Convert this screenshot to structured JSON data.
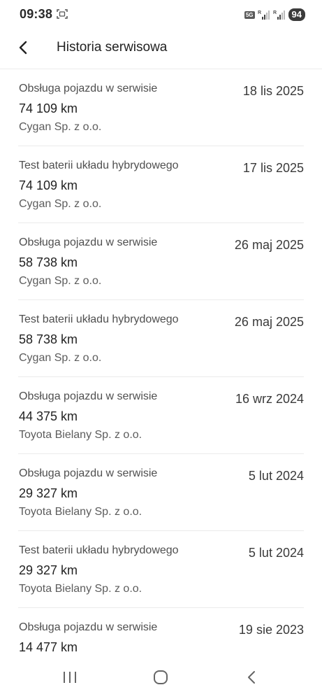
{
  "status_bar": {
    "time": "09:38",
    "network": "5G",
    "battery": "94"
  },
  "header": {
    "title": "Historia serwisowa"
  },
  "entries": [
    {
      "title": "Obsługa pojazdu w serwisie",
      "date": "18 lis 2025",
      "km": "74 109 km",
      "provider": "Cygan Sp. z o.o."
    },
    {
      "title": "Test baterii układu hybrydowego",
      "date": "17 lis 2025",
      "km": "74 109 km",
      "provider": "Cygan Sp. z o.o."
    },
    {
      "title": "Obsługa pojazdu w serwisie",
      "date": "26 maj 2025",
      "km": "58 738 km",
      "provider": "Cygan Sp. z o.o."
    },
    {
      "title": "Test baterii układu hybrydowego",
      "date": "26 maj 2025",
      "km": "58 738 km",
      "provider": "Cygan Sp. z o.o."
    },
    {
      "title": "Obsługa pojazdu w serwisie",
      "date": "16 wrz 2024",
      "km": "44 375 km",
      "provider": "Toyota Bielany Sp. z o.o."
    },
    {
      "title": "Obsługa pojazdu w serwisie",
      "date": "5 lut 2024",
      "km": "29 327 km",
      "provider": "Toyota Bielany Sp. z o.o."
    },
    {
      "title": "Test baterii układu hybrydowego",
      "date": "5 lut 2024",
      "km": "29 327 km",
      "provider": "Toyota Bielany Sp. z o.o."
    },
    {
      "title": "Obsługa pojazdu w serwisie",
      "date": "19 sie 2023",
      "km": "14 477 km",
      "provider": ""
    }
  ],
  "icons": {
    "back": "chevron-left-icon",
    "recents": "recent-apps-icon",
    "home": "home-icon",
    "nav_back": "back-icon"
  }
}
